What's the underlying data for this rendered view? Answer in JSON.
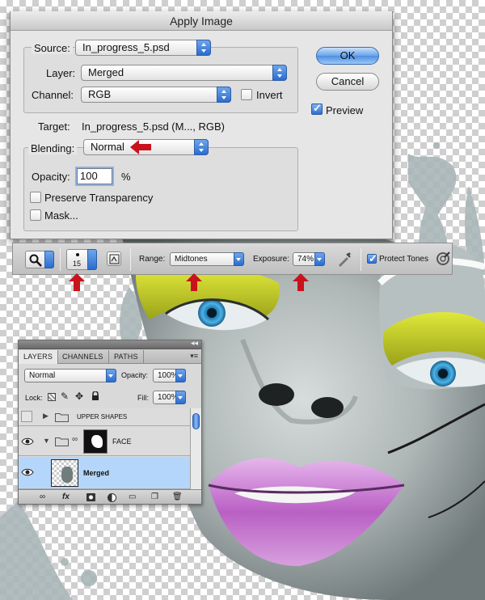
{
  "dialog": {
    "title": "Apply Image",
    "source_label": "Source:",
    "source_value": "In_progress_5.psd",
    "layer_label": "Layer:",
    "layer_value": "Merged",
    "channel_label": "Channel:",
    "channel_value": "RGB",
    "invert_label": "Invert",
    "invert_checked": false,
    "target_label": "Target:",
    "target_value": "In_progress_5.psd (M..., RGB)",
    "blending_label": "Blending:",
    "blending_value": "Normal",
    "opacity_label": "Opacity:",
    "opacity_value": "100",
    "opacity_unit": "%",
    "preserve_label": "Preserve Transparency",
    "preserve_checked": false,
    "mask_label": "Mask...",
    "mask_checked": false,
    "ok_label": "OK",
    "cancel_label": "Cancel",
    "preview_label": "Preview",
    "preview_checked": true
  },
  "options_bar": {
    "brush_size": "15",
    "range_label": "Range:",
    "range_value": "Midtones",
    "exposure_label": "Exposure:",
    "exposure_value": "74%",
    "protect_label": "Protect Tones",
    "protect_checked": true
  },
  "layers": {
    "tabs": [
      "LAYERS",
      "CHANNELS",
      "PATHS"
    ],
    "blend_mode": "Normal",
    "opacity_label": "Opacity:",
    "opacity_value": "100%",
    "lock_label": "Lock:",
    "fill_label": "Fill:",
    "fill_value": "100%",
    "rows": [
      {
        "name": "UPPER SHAPES",
        "type": "group",
        "visible": false
      },
      {
        "name": "FACE",
        "type": "group-masked",
        "visible": true
      },
      {
        "name": "Merged",
        "type": "layer",
        "visible": true,
        "selected": true
      }
    ]
  },
  "colors": {
    "accent_blue": "#4e8fe3",
    "arrow_red": "#c8121c",
    "eyeshadow": "#c6d22c",
    "lips": "#c77fcf",
    "iris": "#2f8fc9"
  }
}
